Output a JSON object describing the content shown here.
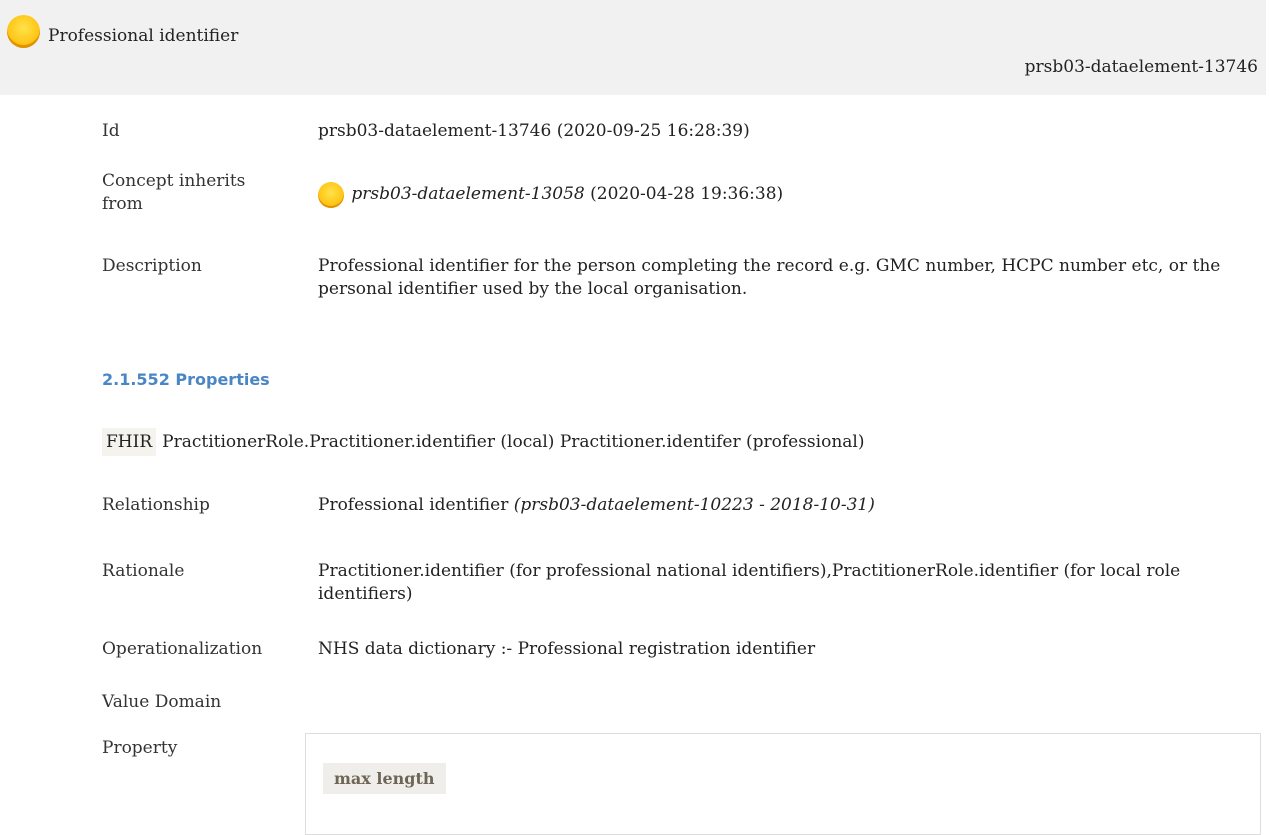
{
  "header": {
    "title": "Professional identifier",
    "id": "prsb03-dataelement-13746",
    "status_icon": "yellow-circle-icon"
  },
  "details": {
    "id_label": "Id",
    "id_value": "prsb03-dataelement-13746 (2020-09-25 16:28:39)",
    "inherits_label_line1": "Concept inherits",
    "inherits_label_line2": "from",
    "inherits_ref": "prsb03-dataelement-13058",
    "inherits_date": "(2020-04-28 19:36:38)",
    "description_label": "Description",
    "description_value": "Professional identifier for the person completing the record e.g. GMC number, HCPC number etc, or the personal identifier used by the local organisation."
  },
  "properties": {
    "heading": "2.1.552 Properties",
    "fhir_tag": "FHIR",
    "fhir_value": "PractitionerRole.Practitioner.identifier (local) Practitioner.identifer (professional)",
    "relationship_label": "Relationship",
    "relationship_value": "Professional identifier",
    "relationship_ref": "(prsb03-dataelement-10223 - 2018-10-31)",
    "rationale_label": "Rationale",
    "rationale_value": "Practitioner.identifier (for professional national identifiers),PractitionerRole.identifier (for local role identifiers)",
    "operationalization_label": "Operationalization",
    "operationalization_value": "NHS data dictionary :- Professional registration identifier",
    "value_domain_label": "Value Domain",
    "property_label": "Property",
    "property_chip": "max length"
  },
  "colors": {
    "header_bg": "#f1f1f1",
    "heading_blue": "#4a86c4",
    "status_yellow": "#ffc81a"
  }
}
